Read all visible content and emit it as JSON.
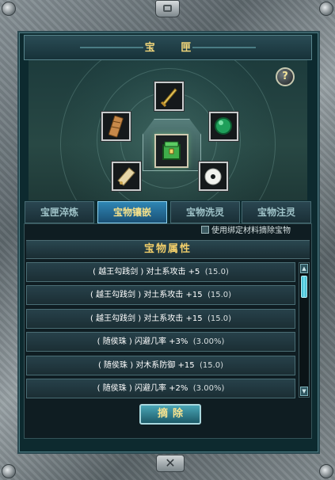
{
  "window": {
    "title": "宝 匣"
  },
  "help": {
    "label": "?"
  },
  "tabs": [
    {
      "label": "宝匣淬炼",
      "active": false
    },
    {
      "label": "宝物镶嵌",
      "active": true
    },
    {
      "label": "宝物洗灵",
      "active": false
    },
    {
      "label": "宝物注灵",
      "active": false
    }
  ],
  "option": {
    "label": "使用绑定材料摘除宝物",
    "checked": false
  },
  "section": {
    "title": "宝物属性"
  },
  "attributes": [
    {
      "item": "( 越王勾践剑 )",
      "stat": "对土系攻击 +5",
      "note": "(15.0)"
    },
    {
      "item": "( 越王勾践剑 )",
      "stat": "对土系攻击 +15",
      "note": "(15.0)"
    },
    {
      "item": "( 越王勾践剑 )",
      "stat": "对土系攻击 +15",
      "note": "(15.0)"
    },
    {
      "item": "( 随侯珠 )",
      "stat": "闪避几率 +3%",
      "note": "(3.00%)"
    },
    {
      "item": "( 随侯珠 )",
      "stat": "对木系防御 +15",
      "note": "(15.0)"
    },
    {
      "item": "( 随侯珠 )",
      "stat": "闪避几率 +2%",
      "note": "(3.00%)"
    }
  ],
  "buttons": {
    "remove": "摘除",
    "close": "✕"
  },
  "colors": {
    "accent_gold": "#f2cf6a",
    "tab_active": "#2f86b4",
    "panel_bg": "#0d2a2f"
  }
}
